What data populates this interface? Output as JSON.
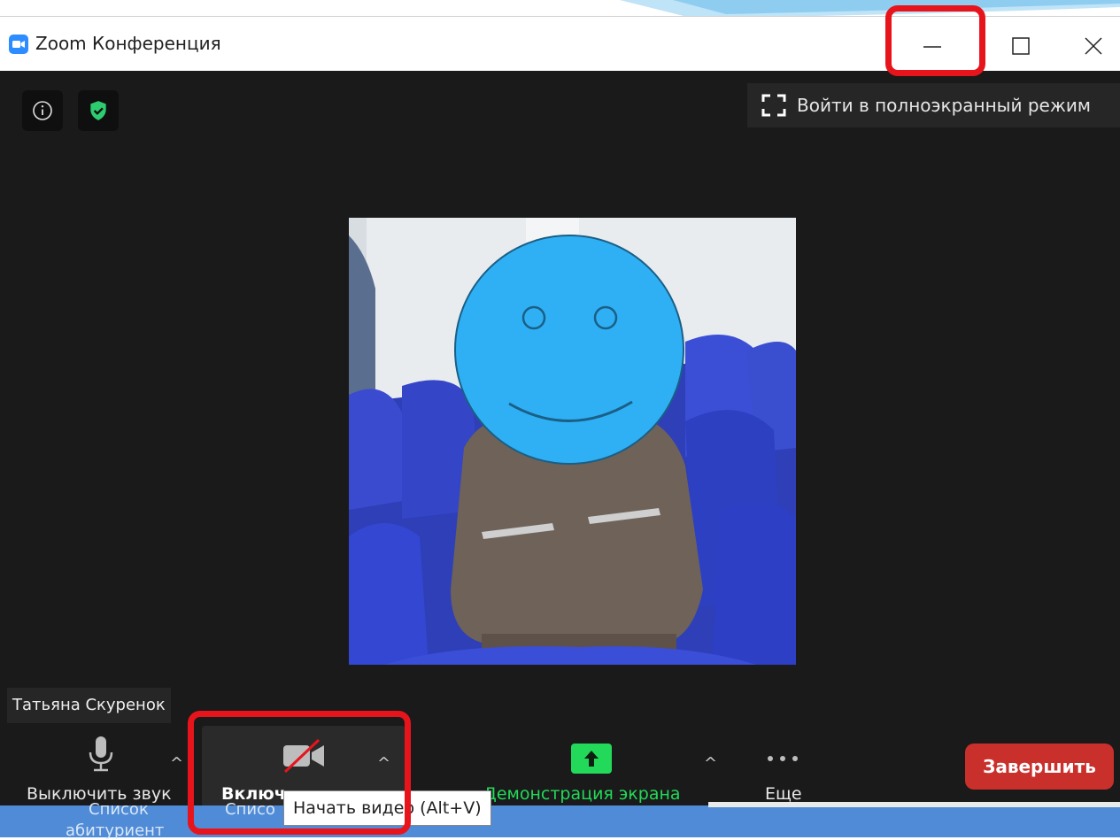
{
  "window": {
    "title": "Zoom Конференция"
  },
  "top_bar": {
    "fullscreen_label": "Войти в полноэкранный режим"
  },
  "participant": {
    "name": "Татьяна Скуренок"
  },
  "toolbar": {
    "mute_label": "Выключить звук",
    "video_label": "Включ",
    "share_label": "Демонстрация экрана",
    "more_label": "Еще",
    "end_label": "Завершить"
  },
  "tooltip": {
    "text": "Начать видео (Alt+V)"
  },
  "taskbar": {
    "item1": "Список",
    "item2": "Списо",
    "item1_line2": "абитуриент"
  },
  "colors": {
    "end_button": "#c9302c",
    "share_green": "#23d959",
    "highlight": "#e8141c",
    "shield_green": "#2ecc71"
  }
}
